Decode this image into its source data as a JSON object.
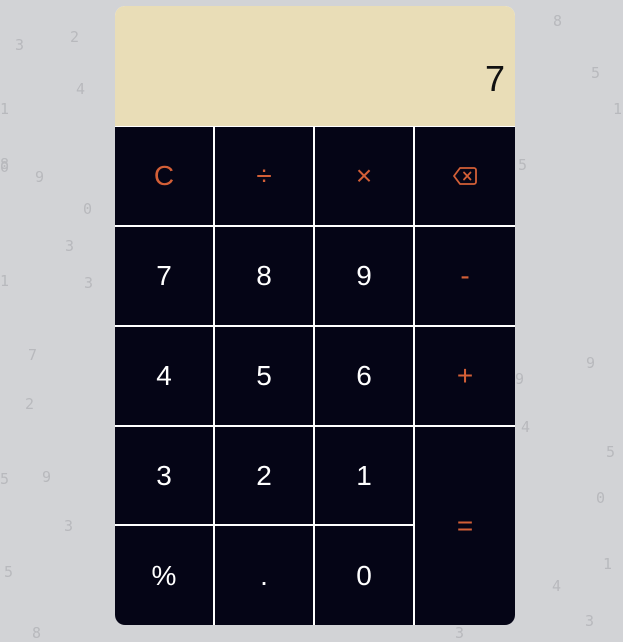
{
  "background_digits": [
    "3",
    "2",
    "1",
    "0",
    "4",
    "6",
    "8",
    "9",
    "0",
    "3",
    "1",
    "3",
    "7",
    "2",
    "5",
    "9",
    "3",
    "5",
    "8",
    "5",
    "1",
    "8",
    "9",
    "4",
    "5",
    "0",
    "9",
    "1",
    "4",
    "3",
    "5",
    "6",
    "3"
  ],
  "display": {
    "value": "7"
  },
  "keys": {
    "clear": "C",
    "divide": "÷",
    "multiply": "×",
    "backspace_icon": "backspace-icon",
    "seven": "7",
    "eight": "8",
    "nine": "9",
    "minus": "-",
    "four": "4",
    "five": "5",
    "six": "6",
    "plus": "+",
    "three": "3",
    "two": "2",
    "one": "1",
    "equals": "=",
    "percent": "%",
    "decimal": ".",
    "zero": "0"
  },
  "colors": {
    "page_background": "#d2d3d6",
    "display_background": "#e9ddb7",
    "key_background": "#050516",
    "number_text": "#ffffff",
    "operator_text": "#d35f37",
    "grid_lines": "#ffffff"
  }
}
